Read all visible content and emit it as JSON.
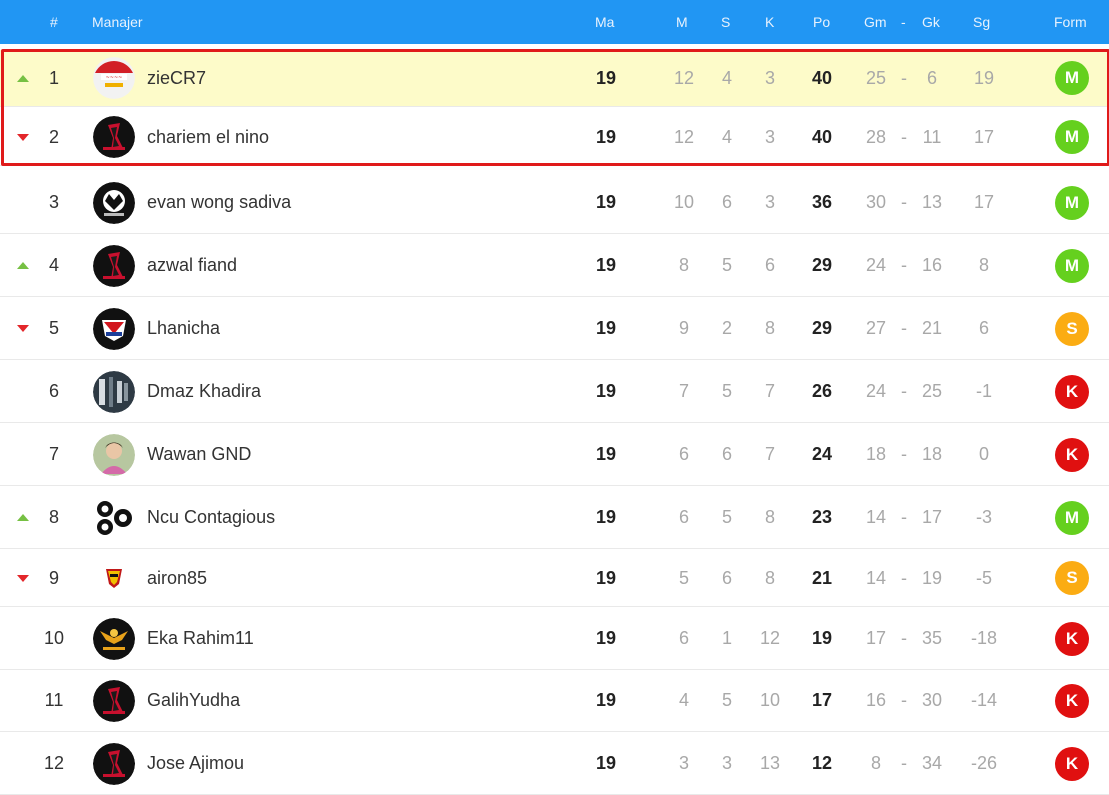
{
  "header": {
    "rank": "#",
    "manager": "Manajer",
    "ma": "Ma",
    "m": "M",
    "s": "S",
    "k": "K",
    "po": "Po",
    "gm": "Gm",
    "dash": "-",
    "gk": "Gk",
    "sg": "Sg",
    "form": "Form"
  },
  "colors": {
    "header_bg": "#2196f3",
    "highlight_row": "#fdfbc9",
    "highlight_border": "#e01a1a",
    "form_win": "#65d01e",
    "form_draw": "#fbac13",
    "form_loss": "#e01010",
    "arrow_up": "#76c043",
    "arrow_down": "#e3262a"
  },
  "rows": [
    {
      "trend": "up",
      "rank": "1",
      "name": "zieCR7",
      "avatar": "red-white-logo",
      "ma": "19",
      "m": "12",
      "s": "4",
      "k": "3",
      "po": "40",
      "gm": "25",
      "gk": "6",
      "sg": "19",
      "form": "M",
      "highlight": true
    },
    {
      "trend": "down",
      "rank": "2",
      "name": "chariem el nino",
      "avatar": "red-black-emblem",
      "ma": "19",
      "m": "12",
      "s": "4",
      "k": "3",
      "po": "40",
      "gm": "28",
      "gk": "11",
      "sg": "17",
      "form": "M",
      "highlight": false
    },
    {
      "trend": "",
      "rank": "3",
      "name": "evan wong sadiva",
      "avatar": "black-white-emblem",
      "ma": "19",
      "m": "10",
      "s": "6",
      "k": "3",
      "po": "36",
      "gm": "30",
      "gk": "13",
      "sg": "17",
      "form": "M",
      "highlight": false
    },
    {
      "trend": "up",
      "rank": "4",
      "name": "azwal fiand",
      "avatar": "red-black-emblem",
      "ma": "19",
      "m": "8",
      "s": "5",
      "k": "6",
      "po": "29",
      "gm": "24",
      "gk": "16",
      "sg": "8",
      "form": "M",
      "highlight": false
    },
    {
      "trend": "down",
      "rank": "5",
      "name": "Lhanicha",
      "avatar": "red-white-crest",
      "ma": "19",
      "m": "9",
      "s": "2",
      "k": "8",
      "po": "29",
      "gm": "27",
      "gk": "21",
      "sg": "6",
      "form": "S",
      "highlight": false
    },
    {
      "trend": "",
      "rank": "6",
      "name": "Dmaz Khadira",
      "avatar": "dark-photo",
      "ma": "19",
      "m": "7",
      "s": "5",
      "k": "7",
      "po": "26",
      "gm": "24",
      "gk": "25",
      "sg": "-1",
      "form": "K",
      "highlight": false
    },
    {
      "trend": "",
      "rank": "7",
      "name": "Wawan GND",
      "avatar": "portrait-photo",
      "ma": "19",
      "m": "6",
      "s": "6",
      "k": "7",
      "po": "24",
      "gm": "18",
      "gk": "18",
      "sg": "0",
      "form": "K",
      "highlight": false
    },
    {
      "trend": "up",
      "rank": "8",
      "name": "Ncu Contagious",
      "avatar": "black-circles-logo",
      "ma": "19",
      "m": "6",
      "s": "5",
      "k": "8",
      "po": "23",
      "gm": "14",
      "gk": "17",
      "sg": "-3",
      "form": "M",
      "highlight": false
    },
    {
      "trend": "down",
      "rank": "9",
      "name": "airon85",
      "avatar": "small-crest",
      "ma": "19",
      "m": "5",
      "s": "6",
      "k": "8",
      "po": "21",
      "gm": "14",
      "gk": "19",
      "sg": "-5",
      "form": "S",
      "highlight": false
    },
    {
      "trend": "",
      "rank": "10",
      "name": "Eka Rahim11",
      "avatar": "gold-eagle-logo",
      "ma": "19",
      "m": "6",
      "s": "1",
      "k": "12",
      "po": "19",
      "gm": "17",
      "gk": "35",
      "sg": "-18",
      "form": "K",
      "highlight": false
    },
    {
      "trend": "",
      "rank": "11",
      "name": "GalihYudha",
      "avatar": "red-black-emblem",
      "ma": "19",
      "m": "4",
      "s": "5",
      "k": "10",
      "po": "17",
      "gm": "16",
      "gk": "30",
      "sg": "-14",
      "form": "K",
      "highlight": false
    },
    {
      "trend": "",
      "rank": "12",
      "name": "Jose Ajimou",
      "avatar": "red-black-emblem",
      "ma": "19",
      "m": "3",
      "s": "3",
      "k": "13",
      "po": "12",
      "gm": "8",
      "gk": "34",
      "sg": "-26",
      "form": "K",
      "highlight": false
    }
  ]
}
